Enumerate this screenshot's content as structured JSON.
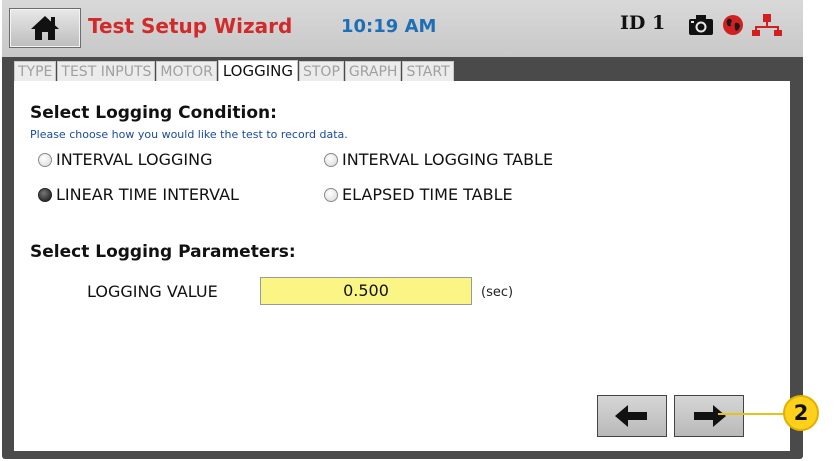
{
  "header": {
    "title": "Test Setup Wizard",
    "time": "10:19 AM",
    "id_label": "ID 1",
    "icons": [
      "home-icon",
      "camera-icon",
      "globe-icon",
      "network-icon"
    ]
  },
  "tabs": [
    {
      "label": "TYPE",
      "active": false
    },
    {
      "label": "TEST INPUTS",
      "active": false
    },
    {
      "label": "MOTOR",
      "active": false
    },
    {
      "label": "LOGGING",
      "active": true
    },
    {
      "label": "STOP",
      "active": false
    },
    {
      "label": "GRAPH",
      "active": false
    },
    {
      "label": "START",
      "active": false
    }
  ],
  "logging_condition": {
    "heading": "Select Logging Condition:",
    "hint": "Please choose how you would like the test to record data.",
    "options": [
      {
        "label": "INTERVAL LOGGING",
        "selected": false
      },
      {
        "label": "INTERVAL LOGGING TABLE",
        "selected": false
      },
      {
        "label": "LINEAR TIME INTERVAL",
        "selected": true
      },
      {
        "label": "ELAPSED TIME TABLE",
        "selected": false
      }
    ]
  },
  "logging_parameters": {
    "heading": "Select Logging Parameters:",
    "field_label": "LOGGING VALUE",
    "field_value": "0.500",
    "unit": "(sec)"
  },
  "navigation": {
    "back_icon": "arrow-left-icon",
    "next_icon": "arrow-right-icon"
  },
  "callout": {
    "number": "2"
  },
  "colors": {
    "title": "#d12a2a",
    "time": "#1e6fb6",
    "input_bg": "#fbf586",
    "callout": "#ffd11a"
  }
}
